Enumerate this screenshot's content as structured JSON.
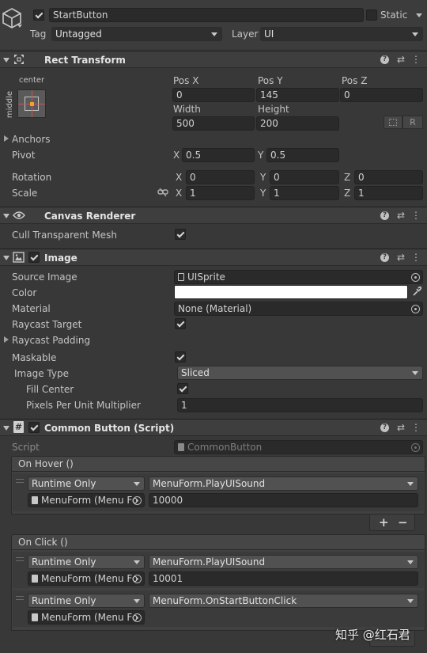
{
  "gameobject": {
    "name": "StartButton",
    "static_label": "Static",
    "tag_label": "Tag",
    "tag_value": "Untagged",
    "layer_label": "Layer",
    "layer_value": "UI"
  },
  "rect_transform": {
    "title": "Rect Transform",
    "anchor_h": "center",
    "anchor_v": "middle",
    "pos_x_label": "Pos X",
    "pos_x": "0",
    "pos_y_label": "Pos Y",
    "pos_y": "145",
    "pos_z_label": "Pos Z",
    "pos_z": "0",
    "width_label": "Width",
    "width": "500",
    "height_label": "Height",
    "height": "200",
    "r_button": "R",
    "anchors_label": "Anchors",
    "pivot_label": "Pivot",
    "pivot_x": "0.5",
    "pivot_y": "0.5",
    "rotation_label": "Rotation",
    "rotation": [
      "0",
      "0",
      "0"
    ],
    "scale_label": "Scale",
    "scale": [
      "1",
      "1",
      "1"
    ],
    "axis": [
      "X",
      "Y",
      "Z"
    ]
  },
  "canvas_renderer": {
    "title": "Canvas Renderer",
    "cull_label": "Cull Transparent Mesh",
    "cull_checked": true
  },
  "image": {
    "title": "Image",
    "source_image_label": "Source Image",
    "source_image": "UISprite",
    "color_label": "Color",
    "color_value": "#ffffff",
    "material_label": "Material",
    "material": "None (Material)",
    "raycast_target_label": "Raycast Target",
    "raycast_padding_label": "Raycast Padding",
    "maskable_label": "Maskable",
    "image_type_label": "Image Type",
    "image_type": "Sliced",
    "fill_center_label": "Fill Center",
    "ppu_label": "Pixels Per Unit Multiplier",
    "ppu": "1"
  },
  "common_button": {
    "title": "Common Button (Script)",
    "script_label": "Script",
    "script_value": "CommonButton",
    "on_hover": {
      "title": "On Hover ()",
      "entries": [
        {
          "mode": "Runtime Only",
          "function": "MenuForm.PlayUISound",
          "object": "MenuForm (Menu Fo",
          "arg": "10000"
        }
      ]
    },
    "on_click": {
      "title": "On Click ()",
      "entries": [
        {
          "mode": "Runtime Only",
          "function": "MenuForm.PlayUISound",
          "object": "MenuForm (Menu Fo",
          "arg": "10001"
        },
        {
          "mode": "Runtime Only",
          "function": "MenuForm.OnStartButtonClick",
          "object": "MenuForm (Menu Fo",
          "arg": ""
        }
      ]
    },
    "plus": "+",
    "minus": "−"
  },
  "watermark": "知乎 @红石君"
}
